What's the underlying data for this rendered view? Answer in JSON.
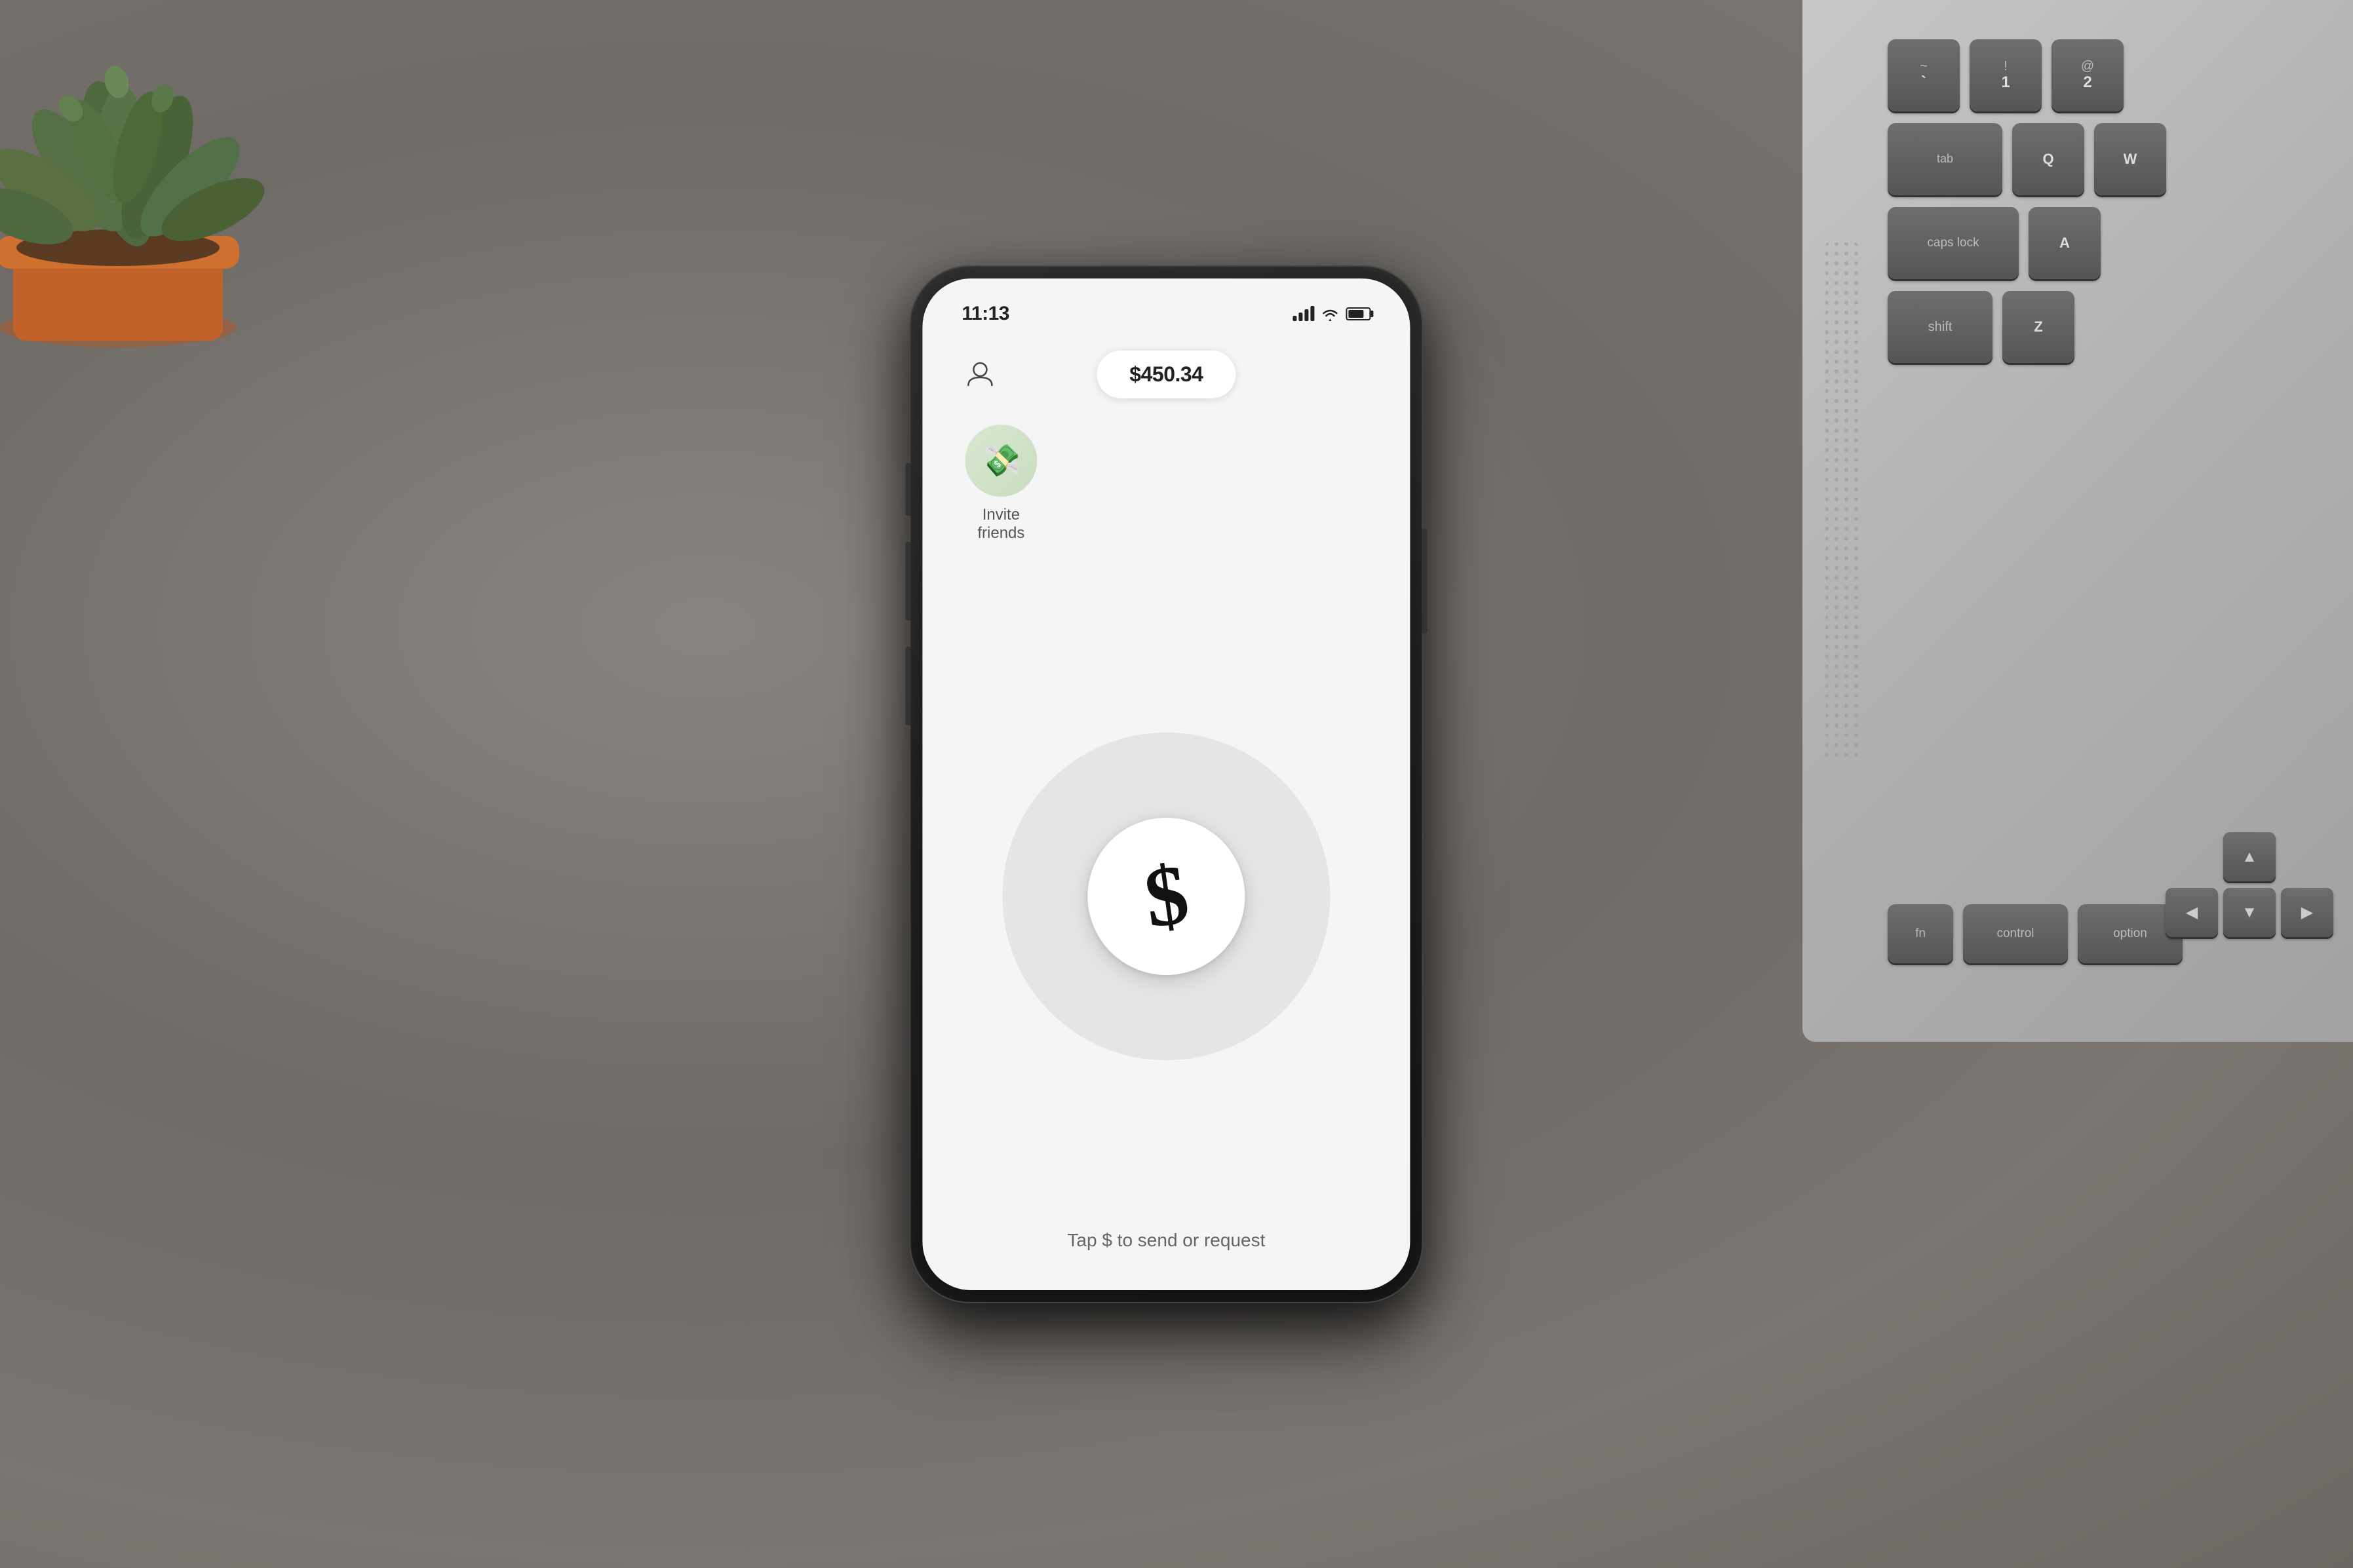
{
  "background": {
    "color": "#7a7570"
  },
  "phone": {
    "status_bar": {
      "time": "11:13",
      "signal_alt": "signal bars",
      "wifi_alt": "wifi",
      "battery_alt": "battery"
    },
    "balance": "$450.34",
    "contacts": [
      {
        "name": "Invite friends",
        "emoji": "💸"
      }
    ],
    "dollar_button_label": "$",
    "instruction": "Tap $ to send or request"
  },
  "keyboard": {
    "rows": [
      [
        {
          "top": "~",
          "bottom": "`"
        },
        {
          "top": "!",
          "bottom": "1"
        },
        {
          "top": "@",
          "bottom": "2"
        }
      ],
      [
        {
          "label": "tab"
        },
        {
          "top": "Q"
        },
        {
          "top": "W"
        }
      ],
      [
        {
          "label": "caps lock"
        },
        {
          "top": "A"
        }
      ],
      [
        {
          "label": "shift"
        },
        {
          "top": "Z"
        }
      ],
      [
        {
          "label": "fn"
        },
        {
          "label": "control"
        },
        {
          "label": "option"
        }
      ]
    ]
  }
}
